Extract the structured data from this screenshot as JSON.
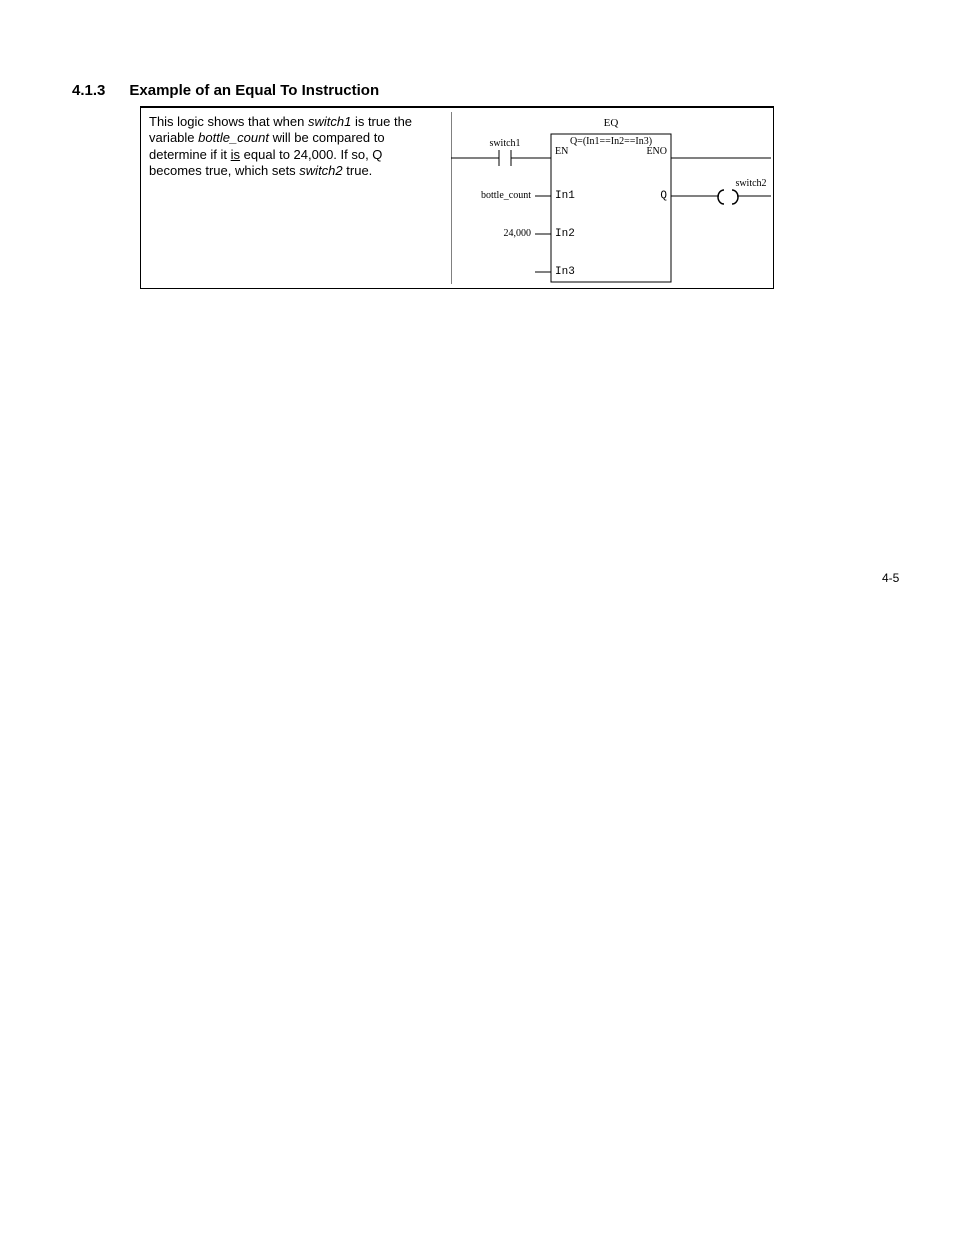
{
  "section": {
    "number": "4.1.3",
    "title": "Example of an Equal To Instruction"
  },
  "description": {
    "p1a": "This logic shows that when ",
    "switch1": "switch1",
    "p1b": " is true the variable ",
    "bottle_count": "bottle_count",
    "p1c": " will be compared to determine if it ",
    "is": "is",
    "p1d": " equal to 24,000. If so, Q becomes true, which sets ",
    "switch2": "switch2",
    "p1e": " true."
  },
  "diagram": {
    "switch1_label": "switch1",
    "bottle_count_label": "bottle_count",
    "value_24000": "24,000",
    "block_title": "EQ",
    "expr": "Q=(In1==In2==In3)",
    "en": "EN",
    "eno": "ENO",
    "in1": "In1",
    "in2": "In2",
    "in3": "In3",
    "q": "Q",
    "switch2_label": "switch2"
  },
  "footer": {
    "page": "4-5"
  }
}
